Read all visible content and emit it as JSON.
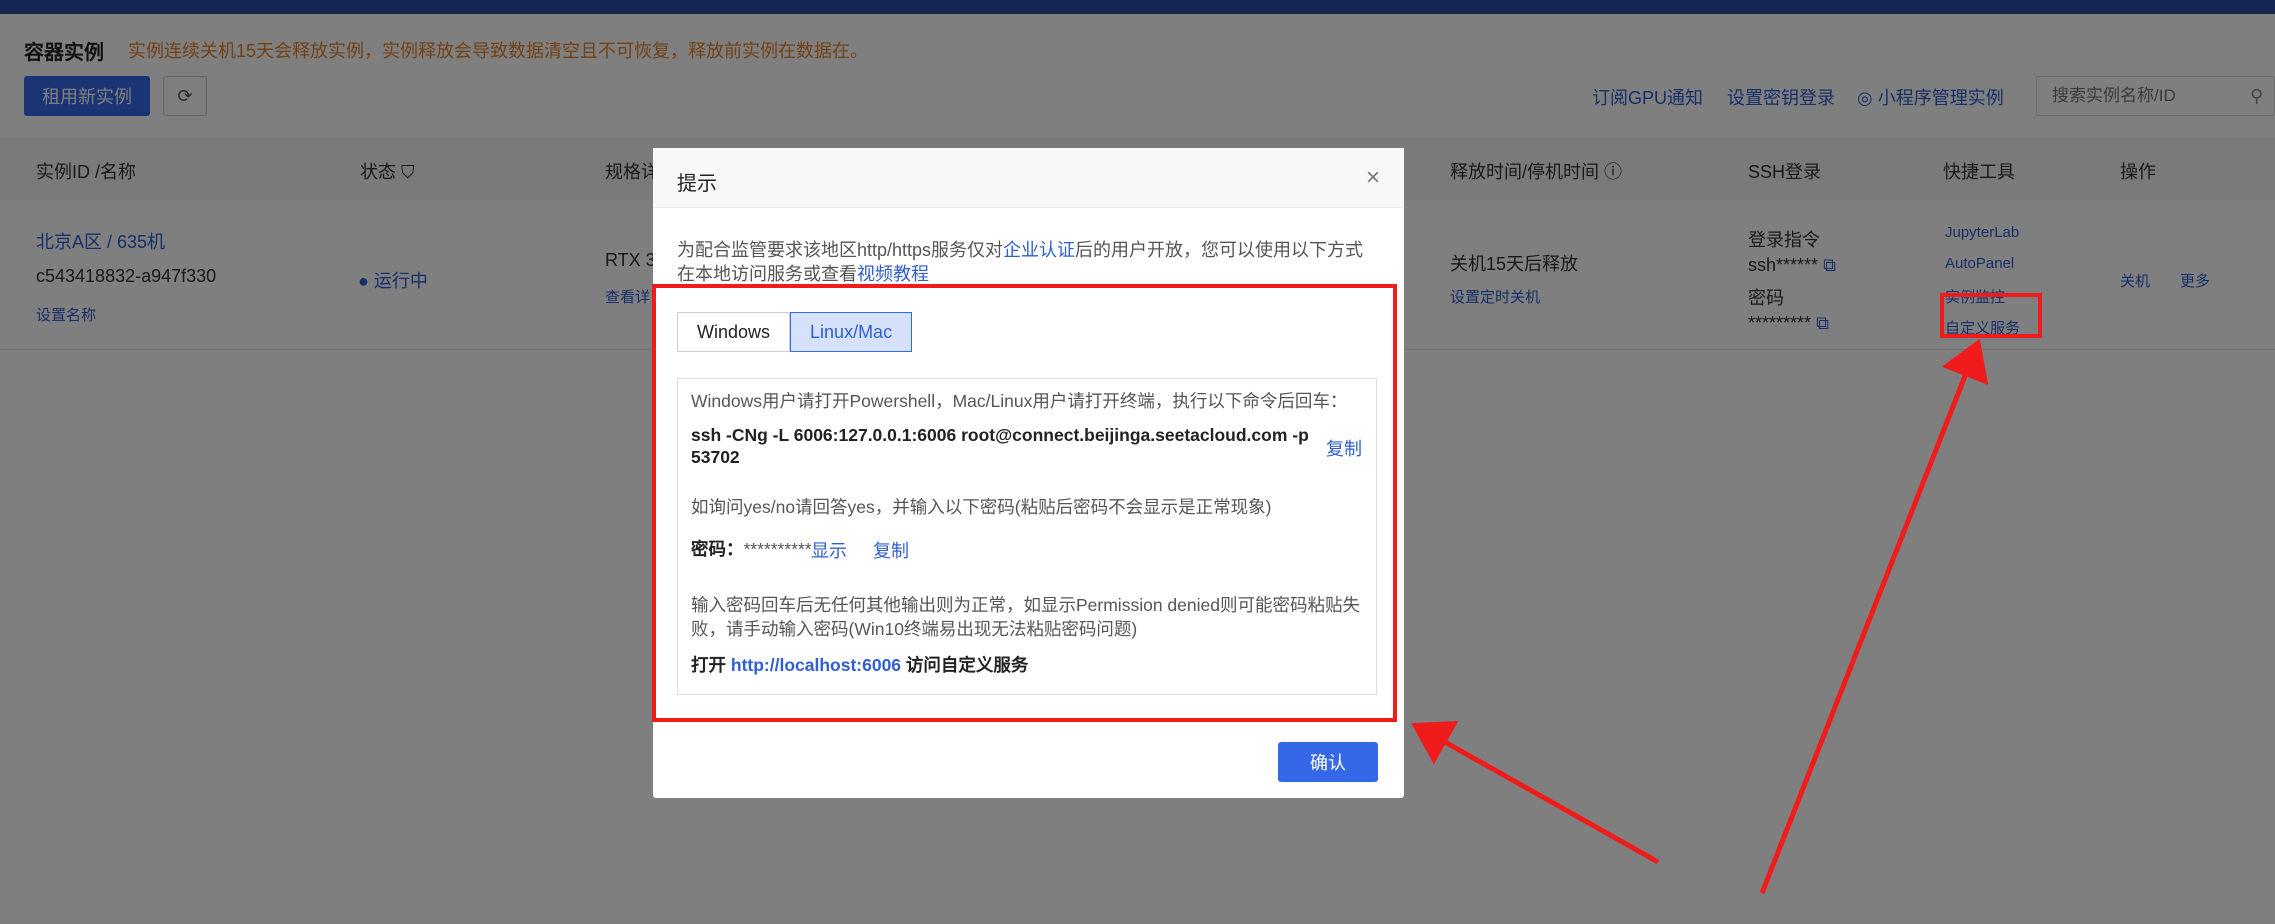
{
  "header": {
    "title": "容器实例",
    "notice": "实例连续关机15天会释放实例，实例释放会导致数据清空且不可恢复，释放前实例在数据在。",
    "rent_button": "租用新实例",
    "links": [
      "订阅GPU通知",
      "设置密钥登录",
      "小程序管理实例"
    ],
    "search_placeholder": "搜索实例名称/ID"
  },
  "table": {
    "columns": [
      "实例ID /名称",
      "状态",
      "规格详",
      "释放时间/停机时间",
      "SSH登录",
      "快捷工具",
      "操作"
    ],
    "row": {
      "region": "北京A区 / 635机",
      "id": "c543418832-a947f330",
      "set_name": "设置名称",
      "status": "● 运行中",
      "spec": "RTX 3",
      "spec_detail": "查看详",
      "release": "关机15天后释放",
      "set_shutdown": "设置定时关机",
      "login_cmd_label": "登录指令",
      "login_cmd": "ssh******",
      "password_label": "密码",
      "password": "*********",
      "tools": [
        "JupyterLab",
        "AutoPanel",
        "实例监控",
        "自定义服务"
      ],
      "actions": [
        "关机",
        "更多"
      ]
    }
  },
  "modal": {
    "title": "提示",
    "desc_pre": "为配合监管要求该地区http/https服务仅对",
    "desc_link1": "企业认证",
    "desc_mid": "后的用户开放，您可以使用以下方式在本地访问服务或查看",
    "desc_link2": "视频教程",
    "tabs": [
      "Windows",
      "Linux/Mac"
    ],
    "instruction": "Windows用户请打开Powershell，Mac/Linux用户请打开终端，执行以下命令后回车：",
    "command_line1": "ssh -CNg -L 6006:127.0.0.1:6006 root@connect.beijinga.seetacloud.com -p",
    "command_line2": "53702",
    "copy": "复制",
    "yes_no": "如询问yes/no请回答yes，并输入以下密码(粘贴后密码不会显示是正常现象)",
    "password_label": "密码：",
    "password_mask": "**********",
    "show": "显示",
    "note_line1": "输入密码回车后无任何其他输出则为正常，如显示Permission denied则可能密码粘贴失",
    "note_line2": "败，请手动输入密码(Win10终端易出现无法粘贴密码问题)",
    "open_pre": "打开",
    "open_url": "http://localhost:6006",
    "open_post": "访问自定义服务",
    "confirm": "确认"
  },
  "colors": {
    "primary": "#3468e8",
    "link": "#2f5fd0",
    "warning": "#e4822a",
    "annotation": "#f01c1c"
  }
}
